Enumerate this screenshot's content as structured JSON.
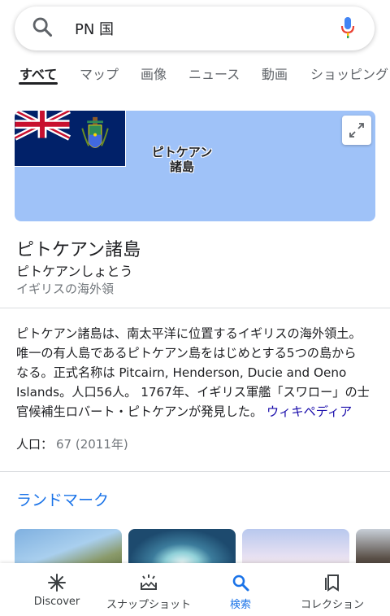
{
  "search": {
    "query": "PN 国",
    "search_icon": "search-icon",
    "mic_icon": "mic-icon"
  },
  "tabs": [
    {
      "label": "すべて",
      "active": true
    },
    {
      "label": "マップ"
    },
    {
      "label": "画像"
    },
    {
      "label": "ニュース"
    },
    {
      "label": "動画"
    },
    {
      "label": "ショッピング"
    }
  ],
  "map": {
    "label_line1": "ピトケアン",
    "label_line2": "諸島",
    "expand_icon": "expand-icon"
  },
  "entity": {
    "title": "ピトケアン諸島",
    "reading": "ピトケアンしょとう",
    "type": "イギリスの海外領"
  },
  "description": {
    "line1": "ピトケアン諸島は、南太平洋に位置するイギリスの海外領土。",
    "line2": "唯一の有人島であるピトケアン島をはじめとする5つの島から",
    "line3": "なる。正式名称は Pitcairn, Henderson, Ducie and Oeno",
    "line4": "Islands。人口56人。 1767年、イギリス軍艦「スワロー」の士",
    "line5": "官候補生ロバート・ピトケアンが発見した。",
    "wiki_link": "ウィキペディア"
  },
  "population": {
    "label": "人口：",
    "value": "67 (2011年)"
  },
  "landmarks": {
    "heading": "ランドマーク"
  },
  "bottom_nav": [
    {
      "label": "Discover",
      "icon": "asterisk-icon"
    },
    {
      "label": "スナップショット",
      "icon": "snapshot-icon"
    },
    {
      "label": "検索",
      "icon": "search-icon",
      "active": true
    },
    {
      "label": "コレクション",
      "icon": "bookmark-icon"
    }
  ],
  "colors": {
    "accent": "#1a73e8",
    "link": "#1a0dab",
    "map_water": "#9fc2f8"
  }
}
